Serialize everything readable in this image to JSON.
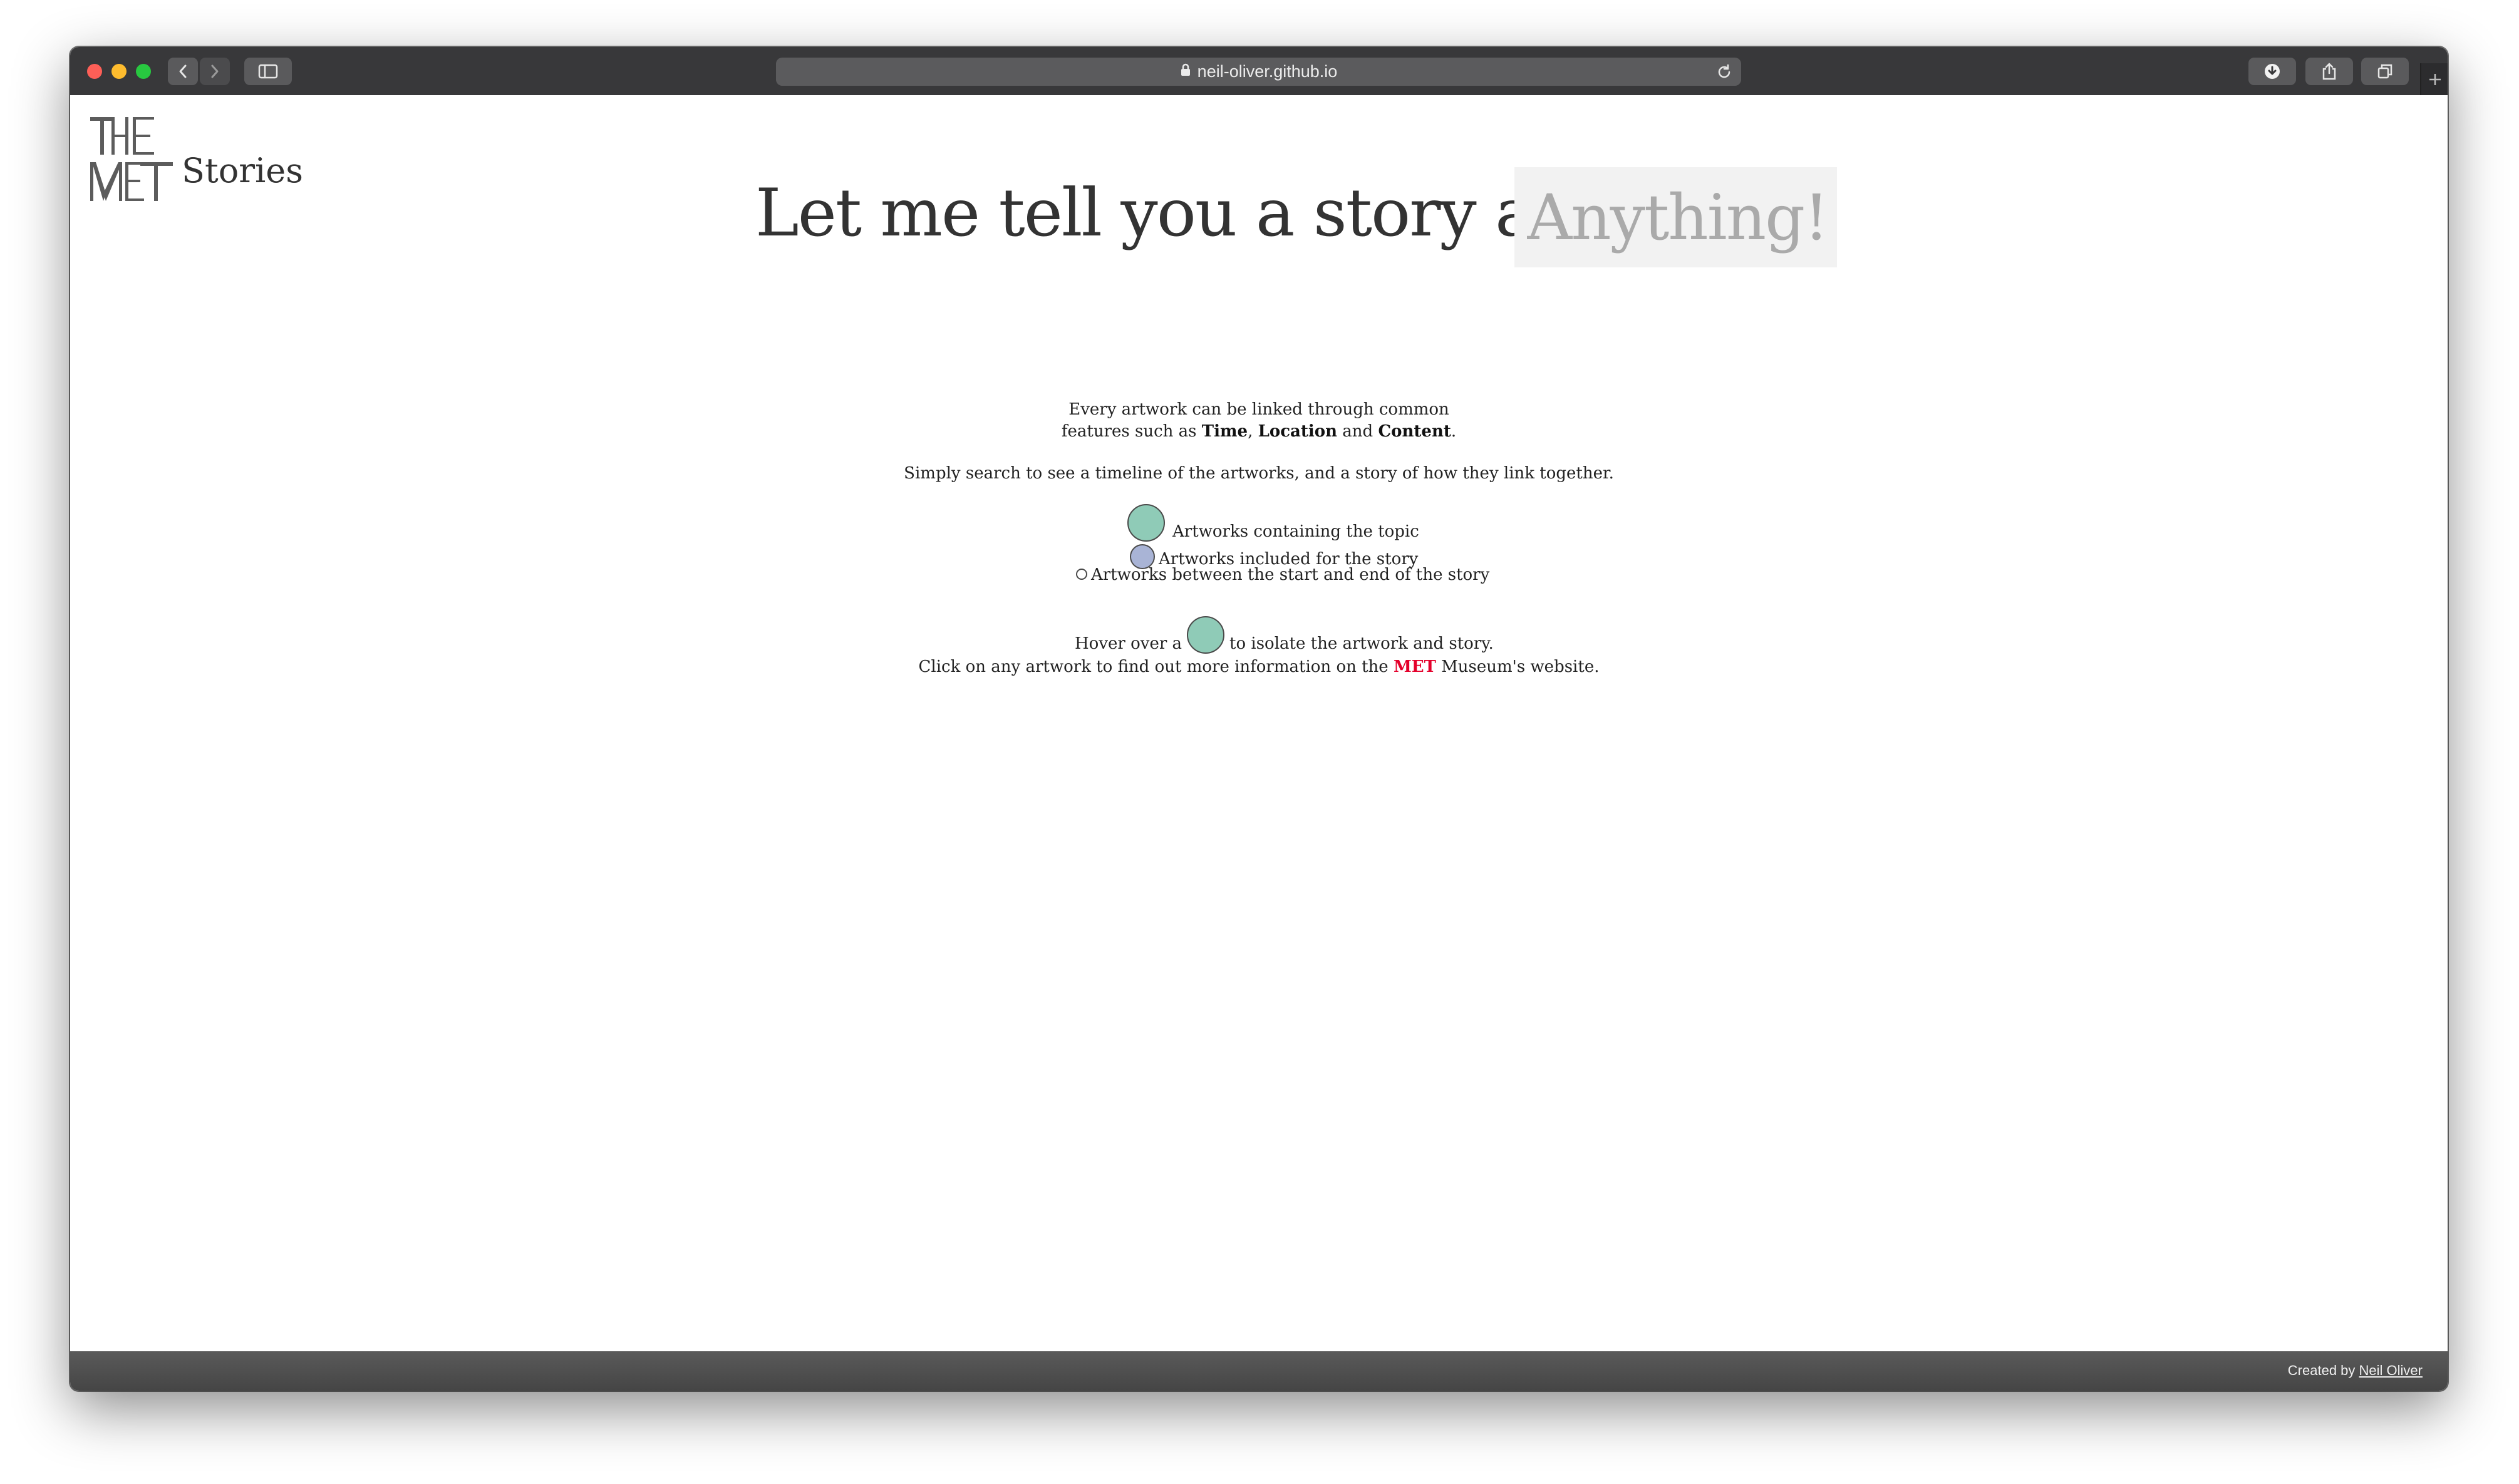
{
  "browser": {
    "url": "neil-oliver.github.io"
  },
  "header": {
    "logo_text": "THE MET",
    "logo_suffix": "Stories",
    "headline": "Let me tell you a story about",
    "search_placeholder": "Anything!"
  },
  "intro": {
    "line1": "Every artwork can be linked through common",
    "line2_prefix": "features such as ",
    "feature_time": "Time",
    "sep1": ", ",
    "feature_location": "Location",
    "sep2": " and ",
    "feature_content": "Content",
    "line2_suffix": ".",
    "instruction": "Simply search to see a timeline of the artworks, and a story of how they link together."
  },
  "legend": {
    "topic": "Artworks containing the topic",
    "story": "Artworks included for the story",
    "between": "Artworks between the start and end of the story"
  },
  "help": {
    "hover_prefix": "Hover over a",
    "hover_suffix": "to isolate the artwork and story.",
    "click_prefix": "Click on any artwork to find out more information on the ",
    "met": "MET",
    "click_suffix": " Museum's website."
  },
  "footer": {
    "credit_prefix": "Created by ",
    "author": "Neil Oliver"
  },
  "colors": {
    "topic_dot": "#8fcbb7",
    "story_dot": "#a9b4d6",
    "between_dot": "#ffffff",
    "met_red": "#e4002b"
  }
}
